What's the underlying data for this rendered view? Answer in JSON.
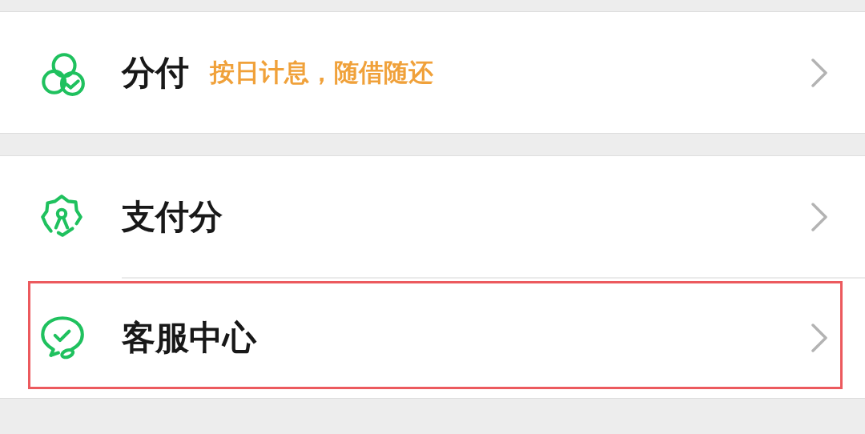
{
  "groups": [
    {
      "items": [
        {
          "label": "分付",
          "note": "按日计息，随借随还",
          "highlighted": false
        }
      ]
    },
    {
      "items": [
        {
          "label": "支付分",
          "highlighted": false
        },
        {
          "label": "客服中心",
          "highlighted": true
        }
      ]
    }
  ]
}
